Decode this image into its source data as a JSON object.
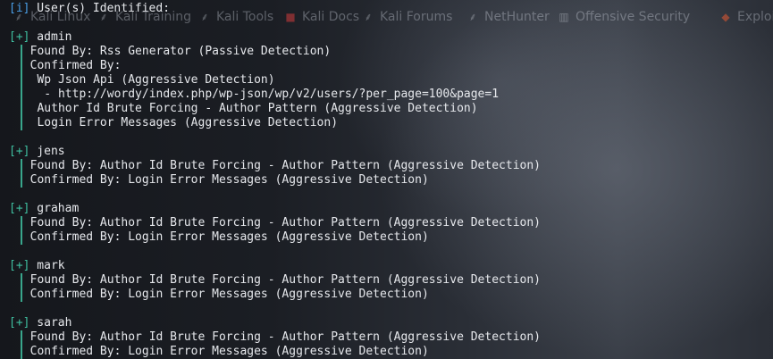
{
  "bookmarks": [
    {
      "label": "Kali Linux",
      "icon": "kali-dragon-icon"
    },
    {
      "label": "Kali Training",
      "icon": "kali-dragon-icon"
    },
    {
      "label": "Kali Tools",
      "icon": "kali-dragon-icon"
    },
    {
      "label": "Kali Docs",
      "icon": "kali-docs-icon"
    },
    {
      "label": "Kali Forums",
      "icon": "kali-dragon-icon"
    },
    {
      "label": "NetHunter",
      "icon": "kali-dragon-icon"
    },
    {
      "label": "Offensive Security",
      "icon": "offsec-icon"
    },
    {
      "label": "Exploit-DB",
      "icon": "exploit-db-icon"
    }
  ],
  "terminal": {
    "header_tag": "[i]",
    "header_text": " User(s) Identified:",
    "users": [
      {
        "tag": "[+]",
        "name": " admin",
        "lines": [
          "  Found By: Rss Generator (Passive Detection)",
          "  Confirmed By:",
          "   Wp Json Api (Aggressive Detection)",
          "    - http://wordy/index.php/wp-json/wp/v2/users/?per_page=100&page=1",
          "   Author Id Brute Forcing - Author Pattern (Aggressive Detection)",
          "   Login Error Messages (Aggressive Detection)"
        ]
      },
      {
        "tag": "[+]",
        "name": " jens",
        "lines": [
          "  Found By: Author Id Brute Forcing - Author Pattern (Aggressive Detection)",
          "  Confirmed By: Login Error Messages (Aggressive Detection)"
        ]
      },
      {
        "tag": "[+]",
        "name": " graham",
        "lines": [
          "  Found By: Author Id Brute Forcing - Author Pattern (Aggressive Detection)",
          "  Confirmed By: Login Error Messages (Aggressive Detection)"
        ]
      },
      {
        "tag": "[+]",
        "name": " mark",
        "lines": [
          "  Found By: Author Id Brute Forcing - Author Pattern (Aggressive Detection)",
          "  Confirmed By: Login Error Messages (Aggressive Detection)"
        ]
      },
      {
        "tag": "[+]",
        "name": " sarah",
        "lines": [
          "  Found By: Author Id Brute Forcing - Author Pattern (Aggressive Detection)",
          "  Confirmed By: Login Error Messages (Aggressive Detection)"
        ]
      }
    ]
  },
  "colors": {
    "info_tag": "#4a9fe8",
    "plus_tag": "#3fbfa0",
    "text": "#e6e8ec"
  }
}
